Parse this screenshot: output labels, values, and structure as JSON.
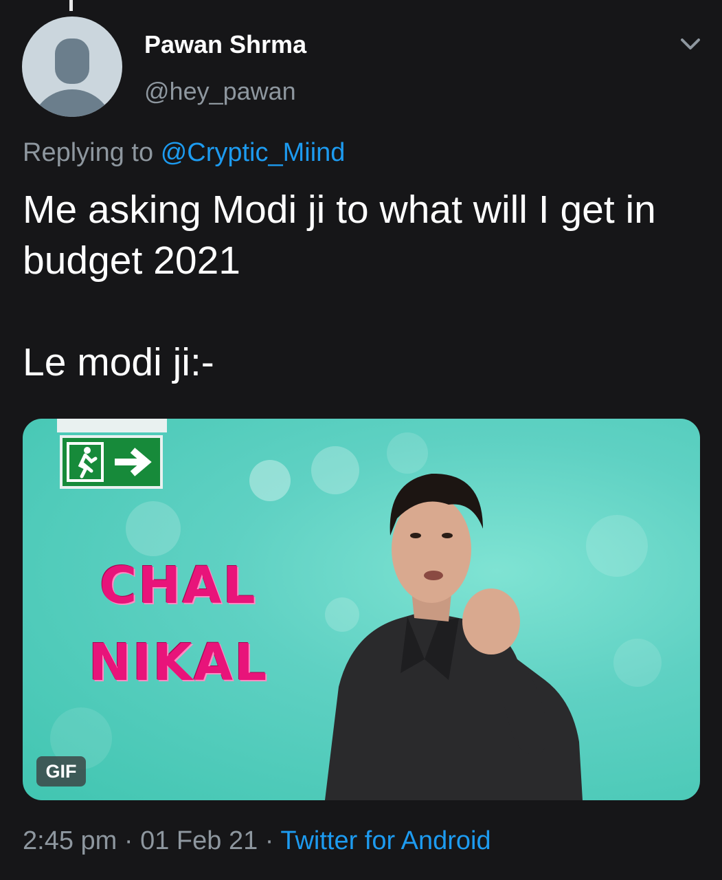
{
  "tweet": {
    "author": {
      "display_name": "Pawan Shrma",
      "handle": "@hey_pawan",
      "avatar_icon": "default-profile-icon"
    },
    "menu_icon": "chevron-down-icon",
    "reply": {
      "prefix": "Replying to",
      "handle": "@Cryptic_Miind"
    },
    "text": {
      "line1": "Me asking Modi ji to what will I get in budget 2021",
      "line2": "Le modi ji:-"
    },
    "media": {
      "type": "gif",
      "badge": "GIF",
      "caption_line1": "CHAL",
      "caption_line2": "NIKAL",
      "exit_sign_icon": "emergency-exit-icon"
    },
    "meta": {
      "time": "2:45 pm",
      "separator": "·",
      "date": "01 Feb 21",
      "source": "Twitter for Android"
    }
  },
  "colors": {
    "background": "#161618",
    "text_primary": "#ffffff",
    "text_secondary": "#8e979f",
    "link": "#1d9bf0",
    "meme_pink": "#e8147a"
  }
}
